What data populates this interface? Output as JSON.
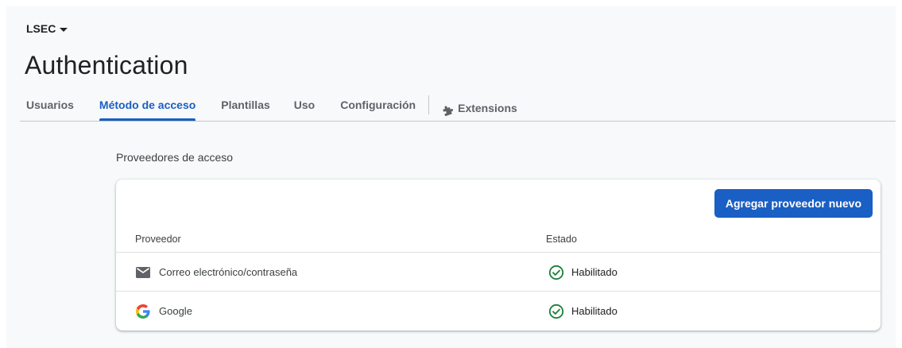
{
  "project": {
    "name": "LSEC"
  },
  "page": {
    "title": "Authentication"
  },
  "tabs": [
    {
      "label": "Usuarios",
      "active": false
    },
    {
      "label": "Método de acceso",
      "active": true
    },
    {
      "label": "Plantillas",
      "active": false
    },
    {
      "label": "Uso",
      "active": false
    },
    {
      "label": "Configuración",
      "active": false
    },
    {
      "label": "Extensions",
      "active": false,
      "icon": "puzzle-icon"
    }
  ],
  "section": {
    "title": "Proveedores de acceso"
  },
  "card": {
    "add_button_label": "Agregar proveedor nuevo",
    "columns": {
      "provider": "Proveedor",
      "status": "Estado"
    },
    "rows": [
      {
        "provider": "Correo electrónico/contraseña",
        "icon": "email-icon",
        "status": "Habilitado"
      },
      {
        "provider": "Google",
        "icon": "google-icon",
        "status": "Habilitado"
      }
    ]
  },
  "colors": {
    "accent": "#1a5fc4",
    "status_ok": "#188038",
    "background": "#f8f9fa"
  }
}
